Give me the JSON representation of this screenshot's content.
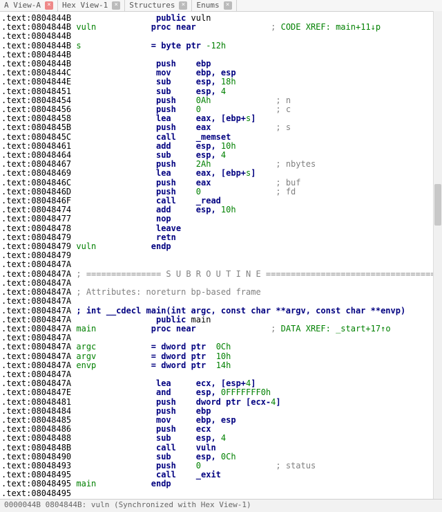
{
  "tabs": [
    {
      "label": "A View-A",
      "closable": true,
      "closeStyle": "red"
    },
    {
      "label": "Hex View-1",
      "closable": true,
      "closeStyle": "gray"
    },
    {
      "label": "Structures",
      "closable": true,
      "closeStyle": "gray"
    },
    {
      "label": "Enums",
      "closable": true,
      "closeStyle": "gray"
    }
  ],
  "lines": [
    {
      "addr": ".text:0804844B",
      "ind": 17,
      "parts": [
        {
          "t": "public ",
          "c": "kw"
        },
        {
          "t": "vuln"
        }
      ]
    },
    {
      "addr": ".text:0804844B ",
      "parts": [
        {
          "t": "vuln           ",
          "c": "str"
        },
        {
          "t": "proc near",
          "c": "kw"
        },
        {
          "t": "               ; ",
          "c": "cmt"
        },
        {
          "t": "CODE XREF: main+11↓p",
          "c": "xref"
        }
      ]
    },
    {
      "addr": ".text:0804844B"
    },
    {
      "addr": ".text:0804844B ",
      "parts": [
        {
          "t": "s",
          "c": "str"
        },
        {
          "t": "              ",
          "c": ""
        },
        {
          "t": "= byte ptr",
          "c": "kw"
        },
        {
          "t": " -12h",
          "c": "num"
        }
      ]
    },
    {
      "addr": ".text:0804844B"
    },
    {
      "addr": ".text:0804844B",
      "ind": 17,
      "parts": [
        {
          "t": "push    ",
          "c": "kw"
        },
        {
          "t": "ebp",
          "c": "kw"
        }
      ]
    },
    {
      "addr": ".text:0804844C",
      "ind": 17,
      "parts": [
        {
          "t": "mov     ",
          "c": "kw"
        },
        {
          "t": "ebp, esp",
          "c": "kw"
        }
      ]
    },
    {
      "addr": ".text:0804844E",
      "ind": 17,
      "parts": [
        {
          "t": "sub     ",
          "c": "kw"
        },
        {
          "t": "esp, ",
          "c": "kw"
        },
        {
          "t": "18h",
          "c": "num"
        }
      ]
    },
    {
      "addr": ".text:08048451",
      "ind": 17,
      "parts": [
        {
          "t": "sub     ",
          "c": "kw"
        },
        {
          "t": "esp, ",
          "c": "kw"
        },
        {
          "t": "4",
          "c": "num"
        }
      ]
    },
    {
      "addr": ".text:08048454",
      "ind": 17,
      "parts": [
        {
          "t": "push    ",
          "c": "kw"
        },
        {
          "t": "0Ah",
          "c": "num"
        },
        {
          "t": "             ; n",
          "c": "cmt"
        }
      ]
    },
    {
      "addr": ".text:08048456",
      "ind": 17,
      "parts": [
        {
          "t": "push    ",
          "c": "kw"
        },
        {
          "t": "0",
          "c": "num"
        },
        {
          "t": "               ; c",
          "c": "cmt"
        }
      ]
    },
    {
      "addr": ".text:08048458",
      "ind": 17,
      "parts": [
        {
          "t": "lea     ",
          "c": "kw"
        },
        {
          "t": "eax, [ebp+",
          "c": "kw"
        },
        {
          "t": "s",
          "c": "str"
        },
        {
          "t": "]",
          "c": "kw"
        }
      ]
    },
    {
      "addr": ".text:0804845B",
      "ind": 17,
      "parts": [
        {
          "t": "push    ",
          "c": "kw"
        },
        {
          "t": "eax",
          "c": "kw"
        },
        {
          "t": "             ; s",
          "c": "cmt"
        }
      ]
    },
    {
      "addr": ".text:0804845C",
      "ind": 17,
      "parts": [
        {
          "t": "call    ",
          "c": "kw"
        },
        {
          "t": "_memset",
          "c": "kw"
        }
      ]
    },
    {
      "addr": ".text:08048461",
      "ind": 17,
      "parts": [
        {
          "t": "add     ",
          "c": "kw"
        },
        {
          "t": "esp, ",
          "c": "kw"
        },
        {
          "t": "10h",
          "c": "num"
        }
      ]
    },
    {
      "addr": ".text:08048464",
      "ind": 17,
      "parts": [
        {
          "t": "sub     ",
          "c": "kw"
        },
        {
          "t": "esp, ",
          "c": "kw"
        },
        {
          "t": "4",
          "c": "num"
        }
      ]
    },
    {
      "addr": ".text:08048467",
      "ind": 17,
      "parts": [
        {
          "t": "push    ",
          "c": "kw"
        },
        {
          "t": "2Ah",
          "c": "num"
        },
        {
          "t": "             ; nbytes",
          "c": "cmt"
        }
      ]
    },
    {
      "addr": ".text:08048469",
      "ind": 17,
      "parts": [
        {
          "t": "lea     ",
          "c": "kw"
        },
        {
          "t": "eax, [ebp+",
          "c": "kw"
        },
        {
          "t": "s",
          "c": "str"
        },
        {
          "t": "]",
          "c": "kw"
        }
      ]
    },
    {
      "addr": ".text:0804846C",
      "ind": 17,
      "parts": [
        {
          "t": "push    ",
          "c": "kw"
        },
        {
          "t": "eax",
          "c": "kw"
        },
        {
          "t": "             ; buf",
          "c": "cmt"
        }
      ]
    },
    {
      "addr": ".text:0804846D",
      "ind": 17,
      "parts": [
        {
          "t": "push    ",
          "c": "kw"
        },
        {
          "t": "0",
          "c": "num"
        },
        {
          "t": "               ; fd",
          "c": "cmt"
        }
      ]
    },
    {
      "addr": ".text:0804846F",
      "ind": 17,
      "parts": [
        {
          "t": "call    ",
          "c": "kw"
        },
        {
          "t": "_read",
          "c": "kw"
        }
      ]
    },
    {
      "addr": ".text:08048474",
      "ind": 17,
      "parts": [
        {
          "t": "add     ",
          "c": "kw"
        },
        {
          "t": "esp, ",
          "c": "kw"
        },
        {
          "t": "10h",
          "c": "num"
        }
      ]
    },
    {
      "addr": ".text:08048477",
      "ind": 17,
      "parts": [
        {
          "t": "nop",
          "c": "kw"
        }
      ]
    },
    {
      "addr": ".text:08048478",
      "ind": 17,
      "parts": [
        {
          "t": "leave",
          "c": "kw"
        }
      ]
    },
    {
      "addr": ".text:08048479",
      "ind": 17,
      "parts": [
        {
          "t": "retn",
          "c": "kw"
        }
      ]
    },
    {
      "addr": ".text:08048479 ",
      "parts": [
        {
          "t": "vuln           ",
          "c": "str"
        },
        {
          "t": "endp",
          "c": "kw"
        }
      ]
    },
    {
      "addr": ".text:08048479"
    },
    {
      "addr": ".text:0804847A"
    },
    {
      "addr": ".text:0804847A ",
      "parts": [
        {
          "t": "; =============== S U B R O U T I N E =======================================",
          "c": "cmt"
        }
      ]
    },
    {
      "addr": ".text:0804847A"
    },
    {
      "addr": ".text:0804847A ",
      "parts": [
        {
          "t": "; Attributes: noreturn bp-based frame",
          "c": "txtc"
        }
      ]
    },
    {
      "addr": ".text:0804847A"
    },
    {
      "addr": ".text:0804847A ",
      "parts": [
        {
          "t": "; int __cdecl main(int argc, const char **argv, const char **envp)",
          "c": "kw"
        }
      ]
    },
    {
      "addr": ".text:0804847A",
      "ind": 17,
      "parts": [
        {
          "t": "public ",
          "c": "kw"
        },
        {
          "t": "main"
        }
      ]
    },
    {
      "addr": ".text:0804847A ",
      "parts": [
        {
          "t": "main           ",
          "c": "str"
        },
        {
          "t": "proc near",
          "c": "kw"
        },
        {
          "t": "               ; ",
          "c": "cmt"
        },
        {
          "t": "DATA XREF: _start+17↑o",
          "c": "xref"
        }
      ]
    },
    {
      "addr": ".text:0804847A"
    },
    {
      "addr": ".text:0804847A ",
      "parts": [
        {
          "t": "argc",
          "c": "str"
        },
        {
          "t": "           ",
          "c": ""
        },
        {
          "t": "= dword ptr",
          "c": "kw"
        },
        {
          "t": "  0Ch",
          "c": "num"
        }
      ]
    },
    {
      "addr": ".text:0804847A ",
      "parts": [
        {
          "t": "argv",
          "c": "str"
        },
        {
          "t": "           ",
          "c": ""
        },
        {
          "t": "= dword ptr",
          "c": "kw"
        },
        {
          "t": "  10h",
          "c": "num"
        }
      ]
    },
    {
      "addr": ".text:0804847A ",
      "parts": [
        {
          "t": "envp",
          "c": "str"
        },
        {
          "t": "           ",
          "c": ""
        },
        {
          "t": "= dword ptr",
          "c": "kw"
        },
        {
          "t": "  14h",
          "c": "num"
        }
      ]
    },
    {
      "addr": ".text:0804847A"
    },
    {
      "addr": ".text:0804847A",
      "ind": 17,
      "parts": [
        {
          "t": "lea     ",
          "c": "kw"
        },
        {
          "t": "ecx, [esp+",
          "c": "kw"
        },
        {
          "t": "4",
          "c": "num"
        },
        {
          "t": "]",
          "c": "kw"
        }
      ]
    },
    {
      "addr": ".text:0804847E",
      "ind": 17,
      "parts": [
        {
          "t": "and     ",
          "c": "kw"
        },
        {
          "t": "esp, ",
          "c": "kw"
        },
        {
          "t": "0FFFFFFF0h",
          "c": "num"
        }
      ]
    },
    {
      "addr": ".text:08048481",
      "ind": 17,
      "parts": [
        {
          "t": "push    ",
          "c": "kw"
        },
        {
          "t": "dword ptr [ecx-",
          "c": "kw"
        },
        {
          "t": "4",
          "c": "num"
        },
        {
          "t": "]",
          "c": "kw"
        }
      ]
    },
    {
      "addr": ".text:08048484",
      "ind": 17,
      "parts": [
        {
          "t": "push    ",
          "c": "kw"
        },
        {
          "t": "ebp",
          "c": "kw"
        }
      ]
    },
    {
      "addr": ".text:08048485",
      "ind": 17,
      "parts": [
        {
          "t": "mov     ",
          "c": "kw"
        },
        {
          "t": "ebp, esp",
          "c": "kw"
        }
      ]
    },
    {
      "addr": ".text:08048486",
      "ind": 17,
      "parts": [
        {
          "t": "push    ",
          "c": "kw"
        },
        {
          "t": "ecx",
          "c": "kw"
        }
      ]
    },
    {
      "addr": ".text:08048488",
      "ind": 17,
      "parts": [
        {
          "t": "sub     ",
          "c": "kw"
        },
        {
          "t": "esp, ",
          "c": "kw"
        },
        {
          "t": "4",
          "c": "num"
        }
      ]
    },
    {
      "addr": ".text:0804848B",
      "ind": 17,
      "parts": [
        {
          "t": "call    ",
          "c": "kw"
        },
        {
          "t": "vuln",
          "c": "kw"
        }
      ]
    },
    {
      "addr": ".text:08048490",
      "ind": 17,
      "parts": [
        {
          "t": "sub     ",
          "c": "kw"
        },
        {
          "t": "esp, ",
          "c": "kw"
        },
        {
          "t": "0Ch",
          "c": "num"
        }
      ]
    },
    {
      "addr": ".text:08048493",
      "ind": 17,
      "parts": [
        {
          "t": "push    ",
          "c": "kw"
        },
        {
          "t": "0",
          "c": "num"
        },
        {
          "t": "               ; status",
          "c": "cmt"
        }
      ]
    },
    {
      "addr": ".text:08048495",
      "ind": 17,
      "parts": [
        {
          "t": "call    ",
          "c": "kw"
        },
        {
          "t": "_exit",
          "c": "kw"
        }
      ]
    },
    {
      "addr": ".text:08048495 ",
      "parts": [
        {
          "t": "main           ",
          "c": "str"
        },
        {
          "t": "endp",
          "c": "kw"
        }
      ]
    },
    {
      "addr": ".text:08048495"
    },
    {
      "addr": ".text:08048495 ",
      "parts": [
        {
          "t": "; ---------------------------------------------------------------------------",
          "c": "cmt"
        }
      ]
    }
  ],
  "status": "0000044B 0804844B: vuln (Synchronized with Hex View-1)"
}
